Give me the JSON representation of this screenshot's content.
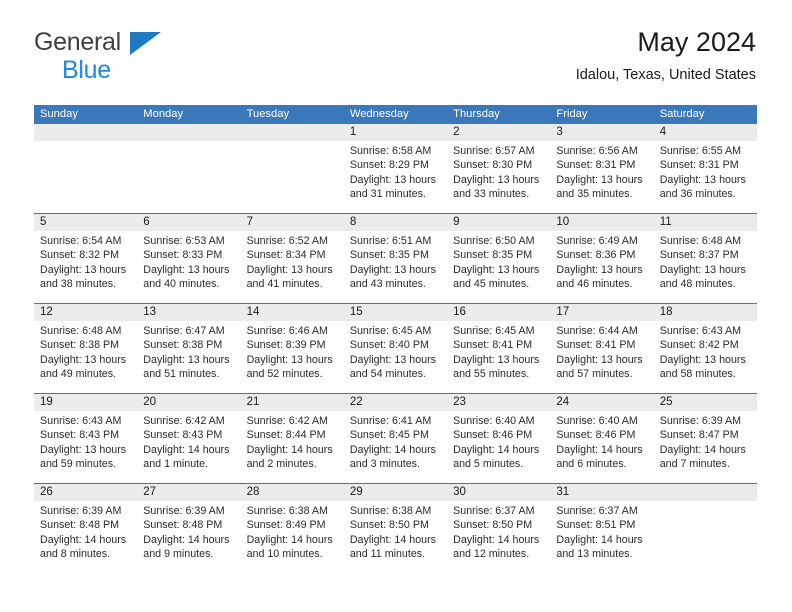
{
  "brand": {
    "name_top": "General",
    "name_bottom": "Blue",
    "triangle_icon": "blue-triangle-icon",
    "color_top": "#3f3f3f",
    "color_bottom": "#1f87dd",
    "triangle_color": "#1f7bc1"
  },
  "header": {
    "title": "May 2024",
    "subtitle": "Idalou, Texas, United States"
  },
  "theme": {
    "header_blue": "#3b78b9",
    "date_band_gray": "#ebebeb",
    "text": "#1a1a1a",
    "body_text": "#2b2b2b"
  },
  "weekdays": [
    "Sunday",
    "Monday",
    "Tuesday",
    "Wednesday",
    "Thursday",
    "Friday",
    "Saturday"
  ],
  "weeks": [
    [
      {
        "day": "",
        "lines": []
      },
      {
        "day": "",
        "lines": []
      },
      {
        "day": "",
        "lines": []
      },
      {
        "day": "1",
        "lines": [
          "Sunrise: 6:58 AM",
          "Sunset: 8:29 PM",
          "Daylight: 13 hours",
          "and 31 minutes."
        ]
      },
      {
        "day": "2",
        "lines": [
          "Sunrise: 6:57 AM",
          "Sunset: 8:30 PM",
          "Daylight: 13 hours",
          "and 33 minutes."
        ]
      },
      {
        "day": "3",
        "lines": [
          "Sunrise: 6:56 AM",
          "Sunset: 8:31 PM",
          "Daylight: 13 hours",
          "and 35 minutes."
        ]
      },
      {
        "day": "4",
        "lines": [
          "Sunrise: 6:55 AM",
          "Sunset: 8:31 PM",
          "Daylight: 13 hours",
          "and 36 minutes."
        ]
      }
    ],
    [
      {
        "day": "5",
        "lines": [
          "Sunrise: 6:54 AM",
          "Sunset: 8:32 PM",
          "Daylight: 13 hours",
          "and 38 minutes."
        ]
      },
      {
        "day": "6",
        "lines": [
          "Sunrise: 6:53 AM",
          "Sunset: 8:33 PM",
          "Daylight: 13 hours",
          "and 40 minutes."
        ]
      },
      {
        "day": "7",
        "lines": [
          "Sunrise: 6:52 AM",
          "Sunset: 8:34 PM",
          "Daylight: 13 hours",
          "and 41 minutes."
        ]
      },
      {
        "day": "8",
        "lines": [
          "Sunrise: 6:51 AM",
          "Sunset: 8:35 PM",
          "Daylight: 13 hours",
          "and 43 minutes."
        ]
      },
      {
        "day": "9",
        "lines": [
          "Sunrise: 6:50 AM",
          "Sunset: 8:35 PM",
          "Daylight: 13 hours",
          "and 45 minutes."
        ]
      },
      {
        "day": "10",
        "lines": [
          "Sunrise: 6:49 AM",
          "Sunset: 8:36 PM",
          "Daylight: 13 hours",
          "and 46 minutes."
        ]
      },
      {
        "day": "11",
        "lines": [
          "Sunrise: 6:48 AM",
          "Sunset: 8:37 PM",
          "Daylight: 13 hours",
          "and 48 minutes."
        ]
      }
    ],
    [
      {
        "day": "12",
        "lines": [
          "Sunrise: 6:48 AM",
          "Sunset: 8:38 PM",
          "Daylight: 13 hours",
          "and 49 minutes."
        ]
      },
      {
        "day": "13",
        "lines": [
          "Sunrise: 6:47 AM",
          "Sunset: 8:38 PM",
          "Daylight: 13 hours",
          "and 51 minutes."
        ]
      },
      {
        "day": "14",
        "lines": [
          "Sunrise: 6:46 AM",
          "Sunset: 8:39 PM",
          "Daylight: 13 hours",
          "and 52 minutes."
        ]
      },
      {
        "day": "15",
        "lines": [
          "Sunrise: 6:45 AM",
          "Sunset: 8:40 PM",
          "Daylight: 13 hours",
          "and 54 minutes."
        ]
      },
      {
        "day": "16",
        "lines": [
          "Sunrise: 6:45 AM",
          "Sunset: 8:41 PM",
          "Daylight: 13 hours",
          "and 55 minutes."
        ]
      },
      {
        "day": "17",
        "lines": [
          "Sunrise: 6:44 AM",
          "Sunset: 8:41 PM",
          "Daylight: 13 hours",
          "and 57 minutes."
        ]
      },
      {
        "day": "18",
        "lines": [
          "Sunrise: 6:43 AM",
          "Sunset: 8:42 PM",
          "Daylight: 13 hours",
          "and 58 minutes."
        ]
      }
    ],
    [
      {
        "day": "19",
        "lines": [
          "Sunrise: 6:43 AM",
          "Sunset: 8:43 PM",
          "Daylight: 13 hours",
          "and 59 minutes."
        ]
      },
      {
        "day": "20",
        "lines": [
          "Sunrise: 6:42 AM",
          "Sunset: 8:43 PM",
          "Daylight: 14 hours",
          "and 1 minute."
        ]
      },
      {
        "day": "21",
        "lines": [
          "Sunrise: 6:42 AM",
          "Sunset: 8:44 PM",
          "Daylight: 14 hours",
          "and 2 minutes."
        ]
      },
      {
        "day": "22",
        "lines": [
          "Sunrise: 6:41 AM",
          "Sunset: 8:45 PM",
          "Daylight: 14 hours",
          "and 3 minutes."
        ]
      },
      {
        "day": "23",
        "lines": [
          "Sunrise: 6:40 AM",
          "Sunset: 8:46 PM",
          "Daylight: 14 hours",
          "and 5 minutes."
        ]
      },
      {
        "day": "24",
        "lines": [
          "Sunrise: 6:40 AM",
          "Sunset: 8:46 PM",
          "Daylight: 14 hours",
          "and 6 minutes."
        ]
      },
      {
        "day": "25",
        "lines": [
          "Sunrise: 6:39 AM",
          "Sunset: 8:47 PM",
          "Daylight: 14 hours",
          "and 7 minutes."
        ]
      }
    ],
    [
      {
        "day": "26",
        "lines": [
          "Sunrise: 6:39 AM",
          "Sunset: 8:48 PM",
          "Daylight: 14 hours",
          "and 8 minutes."
        ]
      },
      {
        "day": "27",
        "lines": [
          "Sunrise: 6:39 AM",
          "Sunset: 8:48 PM",
          "Daylight: 14 hours",
          "and 9 minutes."
        ]
      },
      {
        "day": "28",
        "lines": [
          "Sunrise: 6:38 AM",
          "Sunset: 8:49 PM",
          "Daylight: 14 hours",
          "and 10 minutes."
        ]
      },
      {
        "day": "29",
        "lines": [
          "Sunrise: 6:38 AM",
          "Sunset: 8:50 PM",
          "Daylight: 14 hours",
          "and 11 minutes."
        ]
      },
      {
        "day": "30",
        "lines": [
          "Sunrise: 6:37 AM",
          "Sunset: 8:50 PM",
          "Daylight: 14 hours",
          "and 12 minutes."
        ]
      },
      {
        "day": "31",
        "lines": [
          "Sunrise: 6:37 AM",
          "Sunset: 8:51 PM",
          "Daylight: 14 hours",
          "and 13 minutes."
        ]
      },
      {
        "day": "",
        "lines": []
      }
    ]
  ]
}
